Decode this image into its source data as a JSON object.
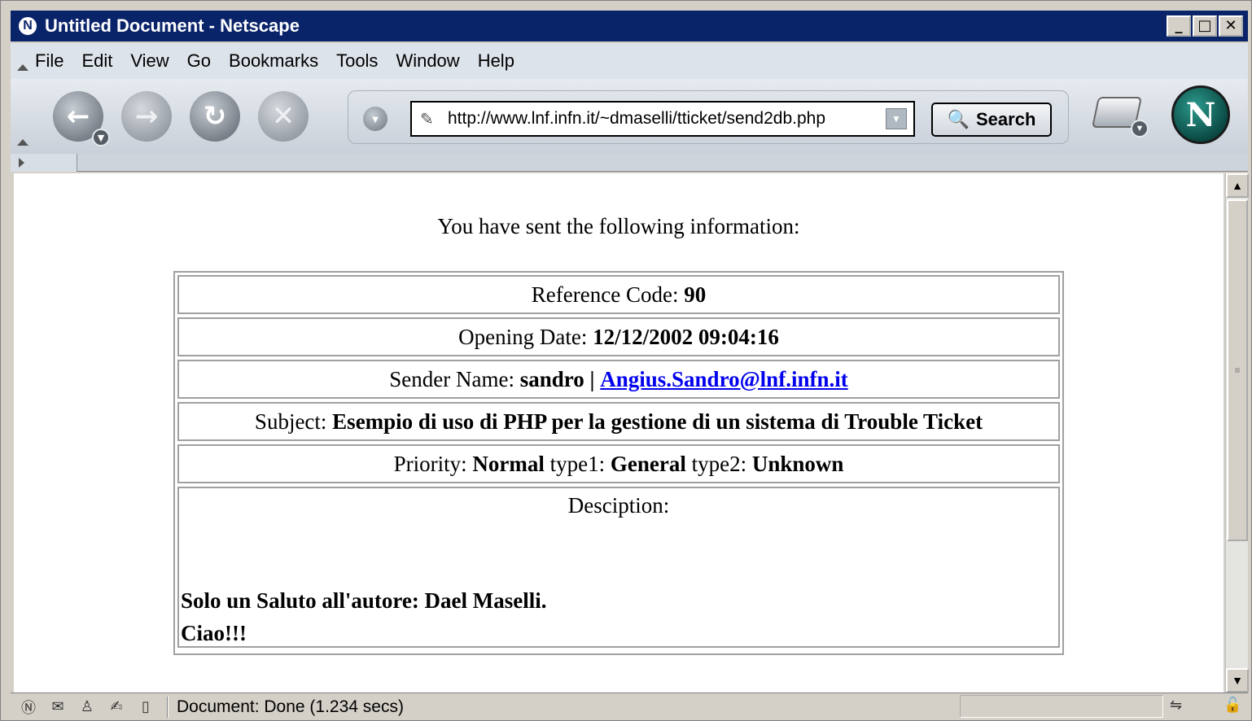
{
  "window": {
    "title": "Untitled Document - Netscape",
    "logo_letter": "N",
    "controls": {
      "minimize": "_",
      "maximize": "□",
      "close": "✕"
    }
  },
  "menu": {
    "items": [
      {
        "label": "File"
      },
      {
        "label": "Edit"
      },
      {
        "label": "View"
      },
      {
        "label": "Go"
      },
      {
        "label": "Bookmarks"
      },
      {
        "label": "Tools"
      },
      {
        "label": "Window"
      },
      {
        "label": "Help"
      }
    ]
  },
  "navigation": {
    "back_glyph": "←",
    "forward_glyph": "→",
    "reload_glyph": "↻",
    "stop_glyph": "✕",
    "dropdown_glyph": "▼",
    "url": "http://www.lnf.infn.it/~dmaselli/tticket/send2db.php",
    "search_label": "Search",
    "search_icon": "magnifier-icon",
    "brand_logo": "N"
  },
  "page": {
    "intro": "You have sent the following information:",
    "reference": {
      "label": "Reference Code:",
      "value": "90"
    },
    "opening": {
      "label": "Opening Date:",
      "value": "12/12/2002 09:04:16"
    },
    "sender": {
      "label": "Sender Name:",
      "name": "sandro",
      "separator": "|",
      "email": "Angius.Sandro@lnf.infn.it"
    },
    "subject": {
      "label": "Subject:",
      "value": "Esempio di uso di PHP per la gestione di un sistema di Trouble Ticket"
    },
    "priority": {
      "label": "Priority:",
      "value": "Normal",
      "type1_label": "type1:",
      "type1_value": "General",
      "type2_label": "type2:",
      "type2_value": "Unknown"
    },
    "description": {
      "label": "Desciption:",
      "line1": "Solo un Saluto all'autore: Dael Maselli.",
      "line2": "Ciao!!!"
    }
  },
  "status": {
    "text": "Document: Done (1.234 secs)",
    "icons": [
      "netscape-icon",
      "mail-icon",
      "aim-icon",
      "composer-icon",
      "address-book-icon"
    ]
  },
  "scrollbar": {
    "up_glyph": "▲",
    "down_glyph": "▼",
    "thumb_grip": "≡"
  },
  "colors": {
    "titlebar": "#0a246a",
    "link": "#0000ee"
  }
}
